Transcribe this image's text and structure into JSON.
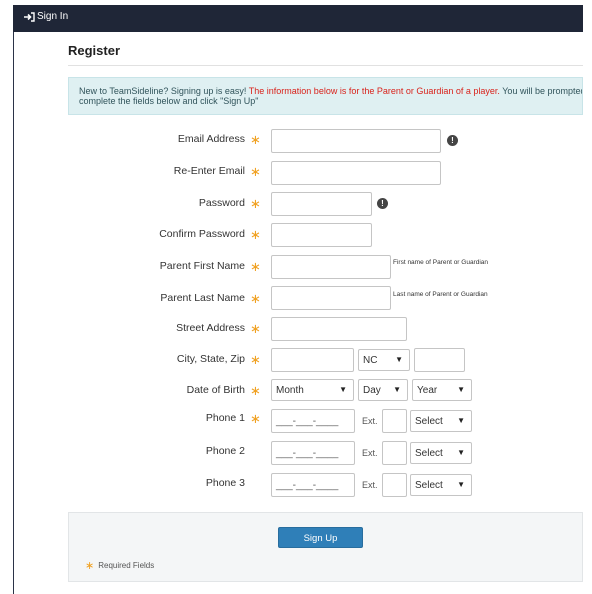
{
  "topbar": {
    "signin_label": "Sign In"
  },
  "page": {
    "title": "Register"
  },
  "notice": {
    "line1_plain": "New to TeamSideline? Signing up is easy! ",
    "line1_red": "The information below is for the Parent or Guardian of a player.",
    "line1_tail": " You will be prompted to",
    "line2": "complete the fields below and click \"Sign Up\""
  },
  "form": {
    "email_label": "Email Address",
    "reenter_email_label": "Re-Enter Email",
    "password_label": "Password",
    "confirm_password_label": "Confirm Password",
    "first_name_label": "Parent First Name",
    "first_name_hint": "First name of Parent or Guardian",
    "last_name_label": "Parent Last Name",
    "last_name_hint": "Last name of Parent or Guardian",
    "street_label": "Street Address",
    "city_state_zip_label": "City, State, Zip",
    "state_value": "NC",
    "dob_label": "Date of Birth",
    "dob_month": "Month",
    "dob_day": "Day",
    "dob_year": "Year",
    "phone1_label": "Phone 1",
    "phone2_label": "Phone 2",
    "phone3_label": "Phone 3",
    "phone_placeholder": "___-___-____",
    "ext_label": "Ext.",
    "phone_type": "Select",
    "required_star": "∗"
  },
  "footer": {
    "signup_label": "Sign Up",
    "required_note": "Required Fields"
  },
  "icons": {
    "signin": "sign-in-icon",
    "info": "exclamation-circle-icon",
    "caret": "caret-down-icon"
  },
  "colors": {
    "topbar": "#1f2637",
    "accent": "#2f7fb8",
    "required": "#f0a020",
    "notice_bg": "#dff0f2",
    "warning_text": "#d9231c"
  }
}
